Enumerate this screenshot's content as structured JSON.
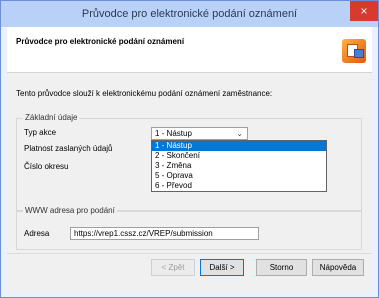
{
  "window": {
    "title": "Průvodce pro elektronické podání oznámení",
    "close_label": "×"
  },
  "header": {
    "heading": "Průvodce pro elektronické podání oznámení"
  },
  "intro": "Tento průvodce slouží k elektronickému podání oznámení zaměstnance:",
  "basic": {
    "legend": "Základní údaje",
    "action_label": "Typ akce",
    "validity_label": "Platnost zaslaných údajů",
    "district_label": "Číslo okresu",
    "action_selected": "1 - Nástup",
    "action_options": [
      "1 - Nástup",
      "2 - Skončení",
      "3 - Změna",
      "5 - Oprava",
      "6 - Převod"
    ]
  },
  "web": {
    "legend": "WWW adresa pro podání",
    "address_label": "Adresa",
    "address_value": "https://vrep1.cssz.cz/VREP/submission"
  },
  "buttons": {
    "back": "< Zpět",
    "next": "Další >",
    "cancel": "Storno",
    "help": "Nápověda"
  }
}
